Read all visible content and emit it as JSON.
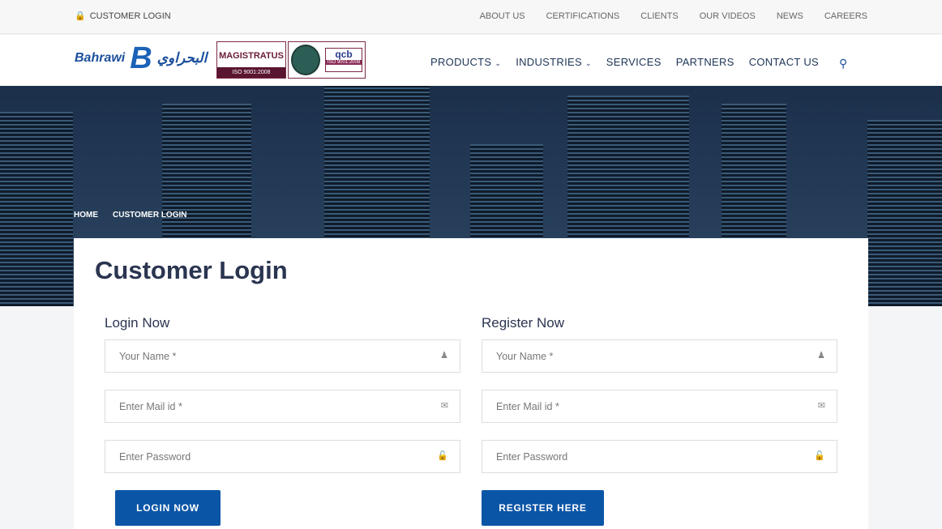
{
  "topbar": {
    "customer_login": "CUSTOMER LOGIN",
    "links": [
      "ABOUT US",
      "CERTIFICATIONS",
      "CLIENTS",
      "OUR VIDEOS",
      "NEWS",
      "CAREERS"
    ]
  },
  "header": {
    "brand_en": "Bahrawi",
    "brand_ar": "البحراوي",
    "cert1": "MAGISTRATUS",
    "cert1_sub": "ISO 9001:2008",
    "cert2": "qcb",
    "cert2_sub": "ISO 9001:2008",
    "nav": [
      {
        "label": "PRODUCTS",
        "dropdown": true
      },
      {
        "label": "INDUSTRIES",
        "dropdown": true
      },
      {
        "label": "SERVICES"
      },
      {
        "label": "PARTNERS"
      },
      {
        "label": "CONTACT US"
      }
    ]
  },
  "breadcrumb": {
    "home": "HOME",
    "current": "CUSTOMER LOGIN"
  },
  "page": {
    "title": "Customer Login"
  },
  "login": {
    "heading": "Login Now",
    "name_placeholder": "Your Name *",
    "mail_placeholder": "Enter Mail id *",
    "password_placeholder": "Enter Password",
    "button": "LOGIN NOW"
  },
  "register": {
    "heading": "Register Now",
    "name_placeholder": "Your Name *",
    "mail_placeholder": "Enter Mail id *",
    "password_placeholder": "Enter Password",
    "button": "REGISTER HERE"
  },
  "colors": {
    "primary": "#0b55a6",
    "heading": "#2a3550"
  }
}
